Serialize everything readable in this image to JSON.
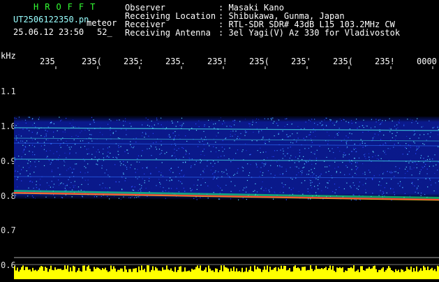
{
  "header": {
    "brand": "HROFFT",
    "filename": "UT2506122350.pn",
    "filename_suffix": "meteor",
    "datetime": "25.06.12 23:50",
    "count": "52_",
    "fields": [
      {
        "label": "Observer",
        "value": ": Masaki Kano"
      },
      {
        "label": "Receiving Location",
        "value": ": Shibukawa, Gunma, Japan"
      },
      {
        "label": "Receiver",
        "value": ": RTL-SDR SDR# 43dB L15 103.2MHz CW"
      },
      {
        "label": "Receiving Antenna",
        "value": ": 3el Yagi(V) Az 330 for Vladivostok"
      }
    ]
  },
  "axis": {
    "y_unit": "kHz",
    "x_ticks": [
      "235",
      "235(",
      "235:",
      "235.",
      "235!",
      "235(",
      "235'",
      "235(",
      "235!",
      "0000"
    ],
    "y_ticks": [
      "1.1",
      "1.0",
      "0.9",
      "0.8",
      "0.7",
      "0.6"
    ]
  },
  "colors": {
    "background": "#000000",
    "noise": "#1a2fd0",
    "carrier": "#ff3030",
    "histogram": "#ffff00",
    "label_green": "#33ff33"
  }
}
